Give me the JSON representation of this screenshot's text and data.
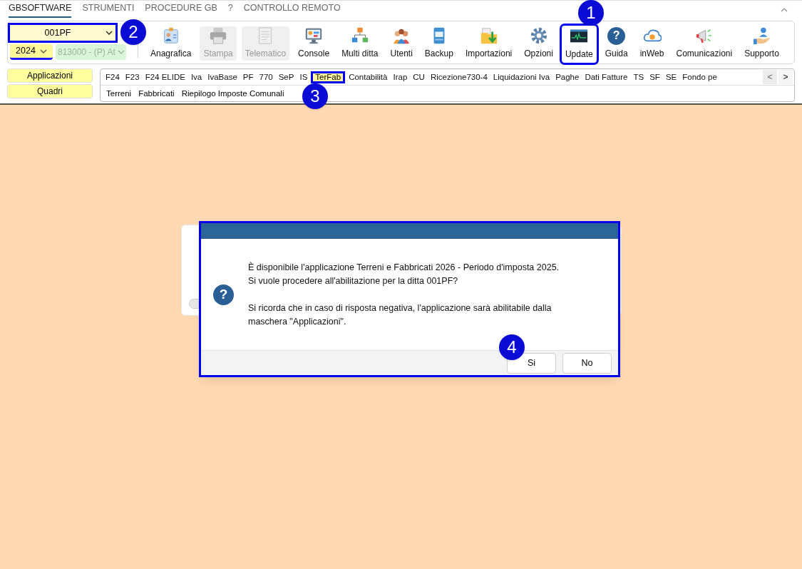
{
  "menu": [
    {
      "label": "GBSOFTWARE",
      "selected": true
    },
    {
      "label": "STRUMENTI",
      "selected": false
    },
    {
      "label": "PROCEDURE GB",
      "selected": false
    },
    {
      "label": "?",
      "selected": false
    },
    {
      "label": "CONTROLLO REMOTO",
      "selected": false
    }
  ],
  "company": {
    "value": "001PF",
    "highlighted": true
  },
  "year": {
    "value": "2024",
    "focused": true
  },
  "activity": {
    "value": "813000 - (P) At",
    "disabled": true
  },
  "toolbar": [
    {
      "label": "Anagrafica",
      "kind": "id-card",
      "disabled": false,
      "highlighted": false
    },
    {
      "label": "Stampa",
      "kind": "printer",
      "disabled": true,
      "highlighted": false
    },
    {
      "label": "Telematico",
      "kind": "document",
      "disabled": true,
      "highlighted": false
    },
    {
      "label": "Console",
      "kind": "monitor",
      "disabled": false,
      "highlighted": false
    },
    {
      "label": "Multi ditta",
      "kind": "hierarchy",
      "disabled": false,
      "highlighted": false
    },
    {
      "label": "Utenti",
      "kind": "users",
      "disabled": false,
      "highlighted": false
    },
    {
      "label": "Backup",
      "kind": "drive",
      "disabled": false,
      "highlighted": false
    },
    {
      "label": "Importazioni",
      "kind": "folder-import",
      "disabled": false,
      "highlighted": false
    },
    {
      "label": "Opzioni",
      "kind": "gear",
      "disabled": false,
      "highlighted": false
    },
    {
      "label": "Update",
      "kind": "pulse-monitor",
      "disabled": false,
      "highlighted": true
    },
    {
      "label": "Guida",
      "kind": "help",
      "glyph": "?",
      "disabled": false,
      "highlighted": false
    },
    {
      "label": "inWeb",
      "kind": "cloud",
      "disabled": false,
      "highlighted": false
    },
    {
      "label": "Comunicazioni",
      "kind": "megaphone",
      "disabled": false,
      "highlighted": false
    },
    {
      "label": "Supporto",
      "kind": "support",
      "disabled": false,
      "highlighted": false
    }
  ],
  "side_buttons": [
    "Applicazioni",
    "Quadri"
  ],
  "app_tabs": [
    {
      "label": "F24",
      "selected": false
    },
    {
      "label": "F23",
      "selected": false
    },
    {
      "label": "F24 ELIDE",
      "selected": false
    },
    {
      "label": "Iva",
      "selected": false
    },
    {
      "label": "IvaBase",
      "selected": false
    },
    {
      "label": "PF",
      "selected": false
    },
    {
      "label": "770",
      "selected": false
    },
    {
      "label": "SeP",
      "selected": false
    },
    {
      "label": "IS",
      "selected": false
    },
    {
      "label": "TerFab",
      "selected": true
    },
    {
      "label": "Contabilità",
      "selected": false
    },
    {
      "label": "Irap",
      "selected": false
    },
    {
      "label": "CU",
      "selected": false
    },
    {
      "label": "Ricezione730-4",
      "selected": false
    },
    {
      "label": "Liquidazioni Iva",
      "selected": false
    },
    {
      "label": "Paghe",
      "selected": false
    },
    {
      "label": "Dati Fatture",
      "selected": false
    },
    {
      "label": "TS",
      "selected": false
    },
    {
      "label": "SF",
      "selected": false
    },
    {
      "label": "SE",
      "selected": false
    },
    {
      "label": "Fondo pe",
      "selected": false
    }
  ],
  "tab_nav": [
    "<",
    ">"
  ],
  "sub_tabs": [
    "Terreni",
    "Fabbricati",
    "Riepilogo Imposte Comunali"
  ],
  "dialog": {
    "icon_glyph": "?",
    "paragraphs": [
      {
        "lines": [
          "È disponibile l'applicazione Terreni e Fabbricati 2026 - Periodo d'imposta 2025.",
          "Si vuole procedere all'abilitazione per la ditta 001PF?"
        ]
      },
      {
        "lines": [
          "Si ricorda che in caso di risposta negativa, l'applicazione sarà abilitabile dalla",
          "maschera \"Applicazioni\"."
        ]
      }
    ],
    "buttons": [
      "Si",
      "No"
    ],
    "highlighted": true
  },
  "callouts": [
    "1",
    "2",
    "3",
    "4"
  ]
}
